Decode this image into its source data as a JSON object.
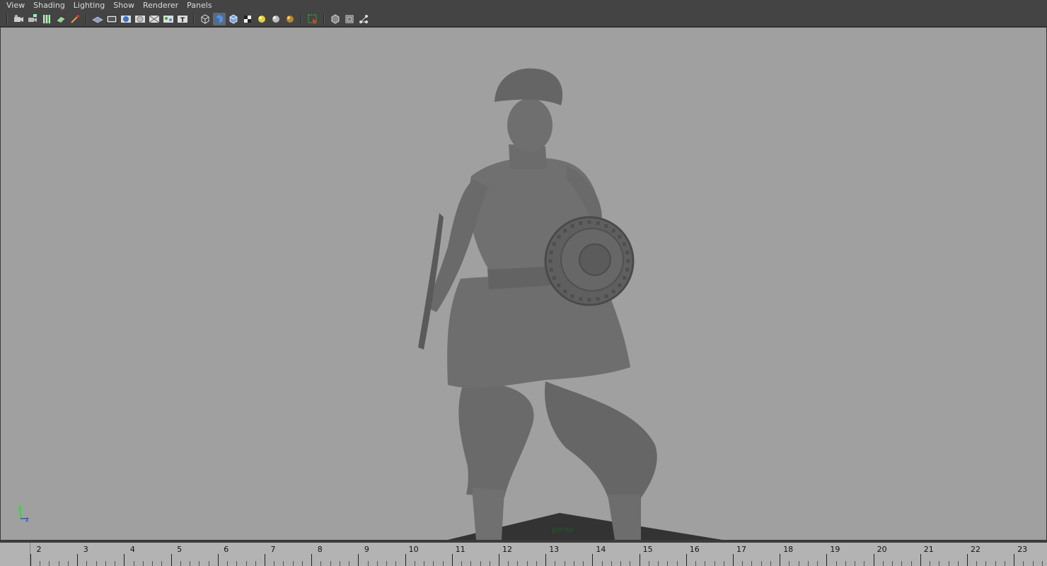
{
  "menubar": {
    "items": [
      "View",
      "Shading",
      "Lighting",
      "Show",
      "Renderer",
      "Panels"
    ]
  },
  "toolbar": {
    "groups": [
      [
        "camera-select-icon",
        "camera-attributes-icon",
        "bookmark-icon",
        "image-plane-icon",
        "grease-pencil-icon"
      ],
      [
        "grid-icon",
        "film-gate-icon",
        "resolution-gate-icon",
        "gate-mask-icon",
        "field-chart-icon",
        "safe-action-icon",
        "safe-title-icon"
      ],
      [
        "wireframe-icon",
        "smooth-shade-icon",
        "wireframe-on-shaded-icon",
        "textured-icon",
        "default-light-icon",
        "all-lights-icon",
        "shadows-icon"
      ],
      [
        "isolate-select-icon"
      ],
      [
        "xray-icon",
        "xray-joints-icon",
        "xray-components-icon"
      ]
    ],
    "active": "smooth-shade-icon"
  },
  "viewport": {
    "camera_label": "persp",
    "background_color": "#a0a0a0",
    "axis": {
      "y": "y",
      "z": "z"
    }
  },
  "timeslider": {
    "ticks": [
      "2",
      "3",
      "4",
      "5",
      "6",
      "7",
      "8",
      "9",
      "10",
      "11",
      "12",
      "13",
      "14",
      "15",
      "16",
      "17",
      "18",
      "19",
      "20",
      "21",
      "22",
      "23"
    ]
  }
}
